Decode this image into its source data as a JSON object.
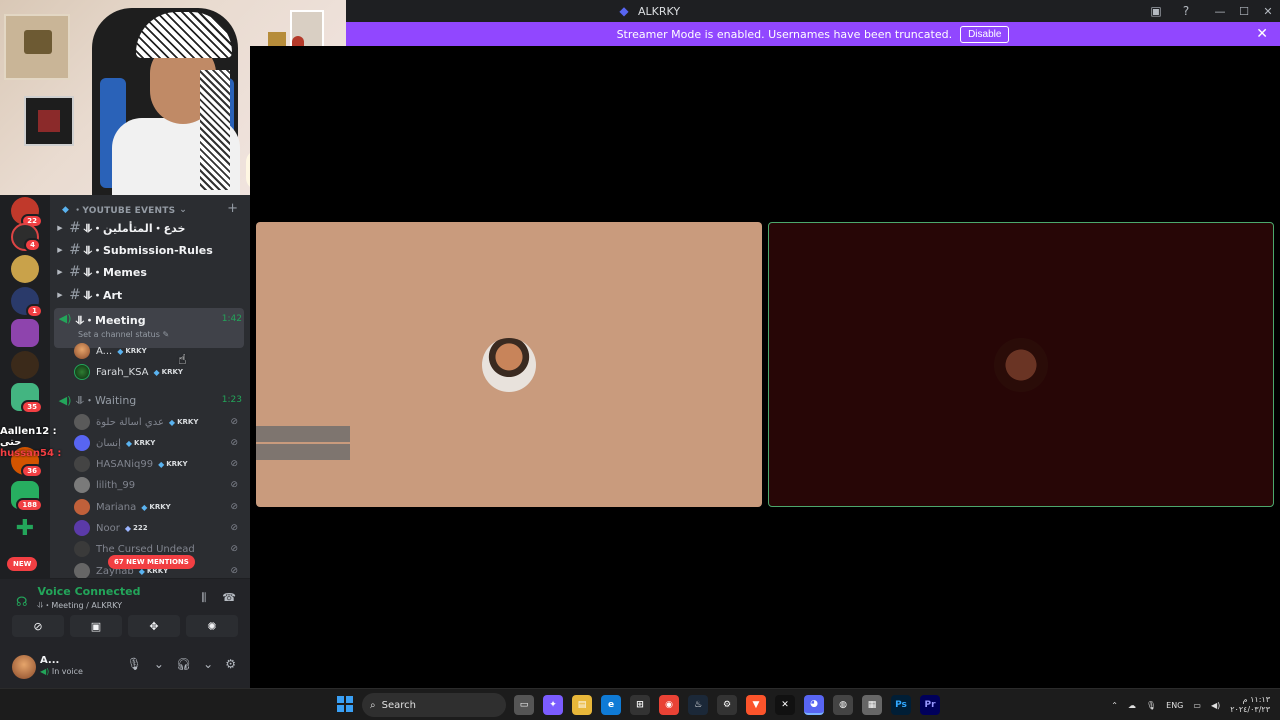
{
  "window": {
    "title": "ALKRKY"
  },
  "banner": {
    "text": "Streamer Mode is enabled. Usernames have been truncated.",
    "disable_label": "Disable"
  },
  "overlay_chat": {
    "line1": "Aallen12 : حتى",
    "line2": "hussan54 :"
  },
  "servers": {
    "badges": [
      "22",
      "4",
      "",
      "1",
      "",
      "",
      "35",
      "",
      "36",
      "188",
      ""
    ],
    "new_label": "NEW"
  },
  "channels": {
    "category": "・YOUTUBE EVENTS",
    "text_channels": [
      {
        "name": "⥥・خدع・المتأملين"
      },
      {
        "name": "⥥・Submission-Rules"
      },
      {
        "name": "⥥・Memes"
      },
      {
        "name": "⥥・Art"
      }
    ],
    "meeting": {
      "name": "⥥・Meeting",
      "time": "1:42",
      "status": "Set a channel status",
      "users": [
        {
          "name": "A...",
          "tag": "KRKY"
        },
        {
          "name": "Farah_KSA",
          "tag": "KRKY"
        }
      ]
    },
    "waiting": {
      "name": "⥥・Waiting",
      "time": "1:23",
      "users": [
        {
          "name": "عدي اسالة حلوة",
          "tag": "KRKY"
        },
        {
          "name": "إنسان",
          "tag": "KRKY"
        },
        {
          "name": "HASANiq99",
          "tag": "KRKY"
        },
        {
          "name": "lilith_99",
          "tag": ""
        },
        {
          "name": "Mariana",
          "tag": "KRKY"
        },
        {
          "name": "Noor",
          "tag": "222"
        },
        {
          "name": "The Cursed Undead",
          "tag": ""
        },
        {
          "name": "Zaynab",
          "tag": "KRKY"
        }
      ]
    },
    "mentions_label": "67 NEW MENTIONS"
  },
  "voice_panel": {
    "title": "Voice Connected",
    "subtitle": "⥥・Meeting / ALKRKY"
  },
  "user_bar": {
    "name": "A...",
    "status": "In voice"
  },
  "taskbar": {
    "search_label": "Search",
    "lang": "ENG",
    "time": "١١:١٣ م",
    "date": "٢٠٢٤/٠٣/٢٣"
  },
  "colors": {
    "banner": "#9147ff",
    "voice_green": "#23a55a",
    "mention_red": "#f23f43"
  }
}
